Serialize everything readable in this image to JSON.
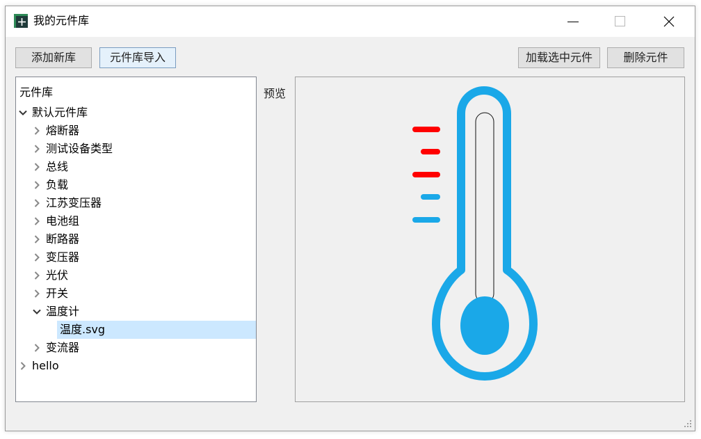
{
  "window": {
    "title": "我的元件库",
    "icon": "app-plus-icon"
  },
  "toolbar": {
    "add_library": "添加新库",
    "import_library": "元件库导入",
    "load_selected": "加载选中元件",
    "delete_component": "删除元件"
  },
  "tree": {
    "header": "元件库",
    "root": "默认元件库",
    "items": [
      {
        "label": "熔断器"
      },
      {
        "label": "测试设备类型"
      },
      {
        "label": "总线"
      },
      {
        "label": "负载"
      },
      {
        "label": "江苏变压器"
      },
      {
        "label": "电池组"
      },
      {
        "label": "断路器"
      },
      {
        "label": "变压器"
      },
      {
        "label": "光伏"
      },
      {
        "label": "开关"
      },
      {
        "label": "温度计",
        "expanded": true,
        "children": [
          {
            "label": "温度.svg",
            "selected": true
          }
        ]
      },
      {
        "label": "变流器"
      }
    ],
    "root2": "hello"
  },
  "preview": {
    "label": "预览",
    "image": "thermometer-svg",
    "colors": {
      "blue": "#1aa8e8",
      "red": "#ff0000"
    }
  }
}
